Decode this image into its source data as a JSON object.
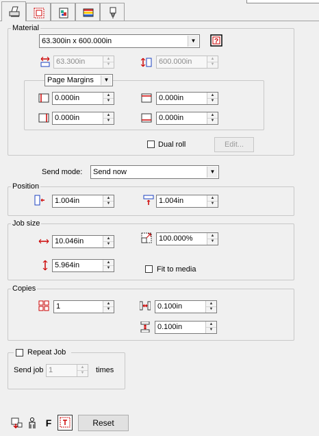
{
  "material": {
    "legend": "Material",
    "size": "63.300in x 600.000in",
    "width": "63.300in",
    "length": "600.000in",
    "page_margins_label": "Page Margins",
    "margin_left": "0.000in",
    "margin_top": "0.000in",
    "margin_right": "0.000in",
    "margin_bottom": "0.000in",
    "dual_roll_label": "Dual roll",
    "edit_label": "Edit..."
  },
  "send_mode": {
    "label": "Send mode:",
    "value": "Send now"
  },
  "position": {
    "legend": "Position",
    "x": "1.004in",
    "y": "1.004in"
  },
  "job_size": {
    "legend": "Job size",
    "width": "10.046in",
    "height": "5.964in",
    "scale": "100.000%",
    "fit_label": "Fit to media"
  },
  "copies": {
    "legend": "Copies",
    "count": "1",
    "h_spacing": "0.100in",
    "v_spacing": "0.100in"
  },
  "repeat": {
    "label": "Repeat Job",
    "send_job_label": "Send job",
    "value": "1",
    "times_label": "times"
  },
  "footer": {
    "f_label": "F",
    "reset_label": "Reset"
  }
}
